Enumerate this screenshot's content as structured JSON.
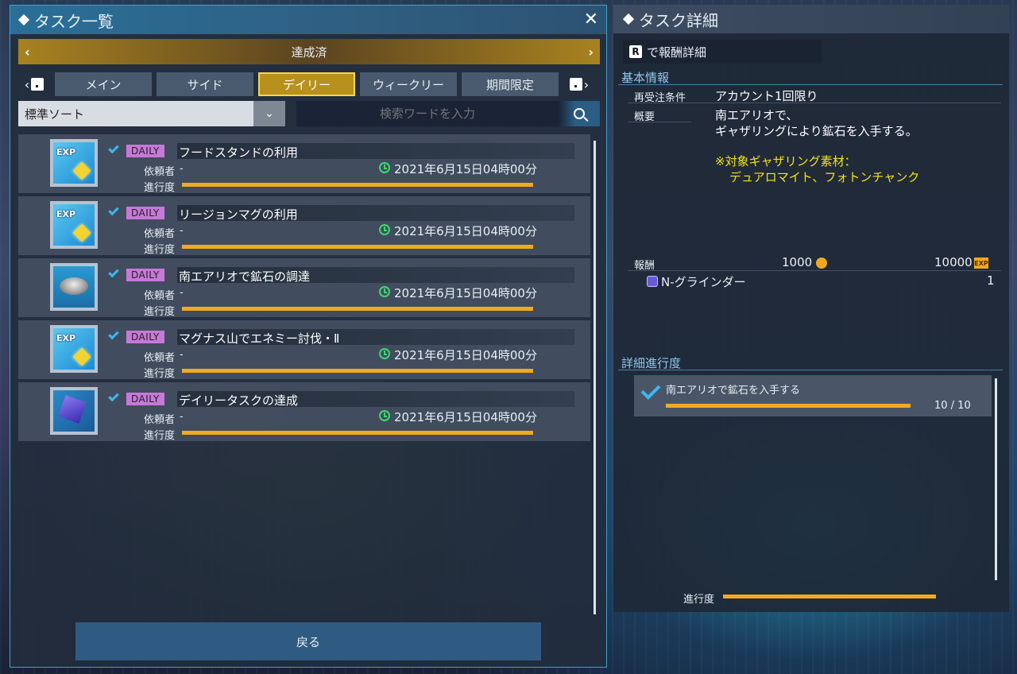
{
  "task_list": {
    "title": "タスク一覧",
    "status_filter": "達成済",
    "tabs": [
      "メイン",
      "サイド",
      "デイリー",
      "ウィークリー",
      "期間限定"
    ],
    "active_tab": "デイリー",
    "sort": {
      "selected": "標準ソート"
    },
    "search": {
      "placeholder": "検索ワードを入力"
    },
    "labels": {
      "requester": "依頼者",
      "progress": "進行度"
    },
    "badge": "DAILY",
    "tasks": [
      {
        "name": "フードスタンドの利用",
        "requester": "-",
        "deadline": "2021年6月15日04時00分",
        "progress": 1.0,
        "icon": "exp-icon"
      },
      {
        "name": "リージョンマグの利用",
        "requester": "-",
        "deadline": "2021年6月15日04時00分",
        "progress": 1.0,
        "icon": "exp-icon"
      },
      {
        "name": "南エアリオで鉱石の調達",
        "requester": "-",
        "deadline": "2021年6月15日04時00分",
        "progress": 1.0,
        "icon": "grinder-icon"
      },
      {
        "name": "マグナス山でエネミー討伐・Ⅱ",
        "requester": "-",
        "deadline": "2021年6月15日04時00分",
        "progress": 1.0,
        "icon": "exp-icon"
      },
      {
        "name": "デイリータスクの達成",
        "requester": "-",
        "deadline": "2021年6月15日04時00分",
        "progress": 1.0,
        "icon": "cube-icon"
      }
    ],
    "back_button": "戻る"
  },
  "task_detail": {
    "title": "タスク詳細",
    "reward_detail_key": "R",
    "reward_detail_label": "で報酬詳細",
    "basic_info_heading": "基本情報",
    "reaccept_label": "再受注条件",
    "reaccept_value": "アカウント1回限り",
    "summary_label": "概要",
    "summary_line1": "南エアリオで、",
    "summary_line2": "ギャザリングにより鉱石を入手する。",
    "note_line1": "※対象ギャザリング素材：",
    "note_line2": "デュアロマイト、フォトンチャンク",
    "reward_label": "報酬",
    "reward_meseta": "1000",
    "reward_exp": "10000",
    "exp_badge": "EXP",
    "reward_item_name": "N-グラインダー",
    "reward_item_count": "1",
    "progress_heading": "詳細進行度",
    "objective": "南エアリオで鉱石を入手する",
    "objective_count": "10 / 10",
    "objective_progress": 1.0,
    "overall_label": "進行度",
    "overall_progress": 1.0
  },
  "colors": {
    "accent": "#f0aa20",
    "daily_badge": "#c878d8",
    "check": "#3cb8f0",
    "clock": "#3cd870",
    "note": "#f4e412"
  }
}
